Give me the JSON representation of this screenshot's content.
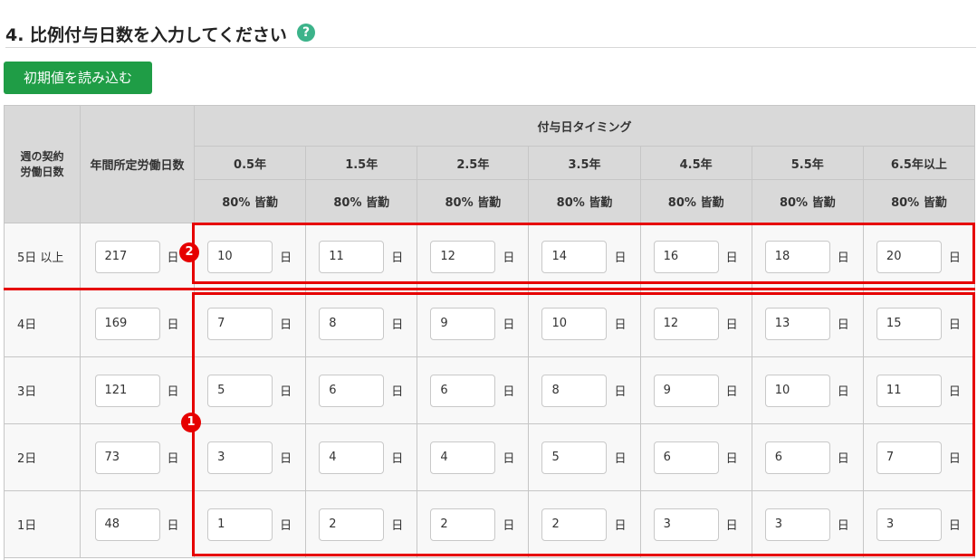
{
  "section": {
    "title": "4. 比例付与日数を入力してください",
    "help_icon": "question-circle-icon",
    "help_glyph": "?"
  },
  "load_button": {
    "label": "初期値を読み込む",
    "color": "#1f9d46"
  },
  "table": {
    "col_week": "週の契約\n労働日数",
    "col_year": "年間所定労働日数",
    "timing_header": "付与日タイミング",
    "timings": [
      "0.5年",
      "1.5年",
      "2.5年",
      "3.5年",
      "4.5年",
      "5.5年",
      "6.5年以上"
    ],
    "attendance": [
      "80% 皆勤",
      "80% 皆勤",
      "80% 皆勤",
      "80% 皆勤",
      "80% 皆勤",
      "80% 皆勤",
      "80% 皆勤"
    ],
    "unit": "日",
    "rows": [
      {
        "label": "5日 以上",
        "annual": "217",
        "grants": [
          "10",
          "11",
          "12",
          "14",
          "16",
          "18",
          "20"
        ]
      },
      {
        "label": "4日",
        "annual": "169",
        "grants": [
          "7",
          "8",
          "9",
          "10",
          "12",
          "13",
          "15"
        ]
      },
      {
        "label": "3日",
        "annual": "121",
        "grants": [
          "5",
          "6",
          "6",
          "8",
          "9",
          "10",
          "11"
        ]
      },
      {
        "label": "2日",
        "annual": "73",
        "grants": [
          "3",
          "4",
          "4",
          "5",
          "6",
          "6",
          "7"
        ]
      },
      {
        "label": "1日",
        "annual": "48",
        "grants": [
          "1",
          "2",
          "2",
          "2",
          "3",
          "3",
          "3"
        ]
      }
    ]
  },
  "annotations": {
    "marker_1": "1",
    "marker_2": "2",
    "highlight_color": "#e60000"
  }
}
